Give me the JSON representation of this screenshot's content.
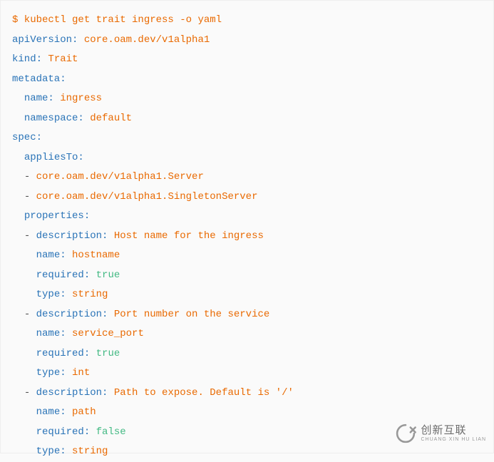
{
  "cmd": {
    "prompt": "$ kubectl get trait ingress ",
    "flag": "-o",
    "arg": " yaml"
  },
  "l1_key": "apiVersion:",
  "l1_val": " core.oam.dev/v1alpha1",
  "l2_key": "kind:",
  "l2_val": " Trait",
  "l3_key": "metadata:",
  "l4_pad": "  ",
  "l4_key": "name:",
  "l4_val": " ingress",
  "l5_pad": "  ",
  "l5_key": "namespace:",
  "l5_val": " default",
  "l6_key": "spec:",
  "l7_pad": "  ",
  "l7_key": "appliesTo:",
  "l8_pad": "  ",
  "l8_dash": "-",
  "l8_val": " core.oam.dev/v1alpha1.Server",
  "l9_pad": "  ",
  "l9_dash": "-",
  "l9_val": " core.oam.dev/v1alpha1.SingletonServer",
  "l10_pad": "  ",
  "l10_key": "properties:",
  "l11_pad": "  ",
  "l11_dash": "-",
  "l11_key": " description:",
  "l11_val": " Host name for the ingress",
  "l12_pad": "    ",
  "l12_key": "name:",
  "l12_val": " hostname",
  "l13_pad": "    ",
  "l13_key": "required:",
  "l13_val": " true",
  "l14_pad": "    ",
  "l14_key": "type:",
  "l14_val": " string",
  "l15_pad": "  ",
  "l15_dash": "-",
  "l15_key": " description:",
  "l15_val": " Port number on the service",
  "l16_pad": "    ",
  "l16_key": "name:",
  "l16_val": " service_port",
  "l17_pad": "    ",
  "l17_key": "required:",
  "l17_val": " true",
  "l18_pad": "    ",
  "l18_key": "type:",
  "l18_val": " int",
  "l19_pad": "  ",
  "l19_dash": "-",
  "l19_key": " description:",
  "l19_val": " Path to expose. Default is '/'",
  "l20_pad": "    ",
  "l20_key": "name:",
  "l20_val": " path",
  "l21_pad": "    ",
  "l21_key": "required:",
  "l21_val": " false",
  "l22_pad": "    ",
  "l22_key": "type:",
  "l22_val": " string",
  "watermark": {
    "cn": "创新互联",
    "en": "CHUANG XIN HU LIAN"
  }
}
